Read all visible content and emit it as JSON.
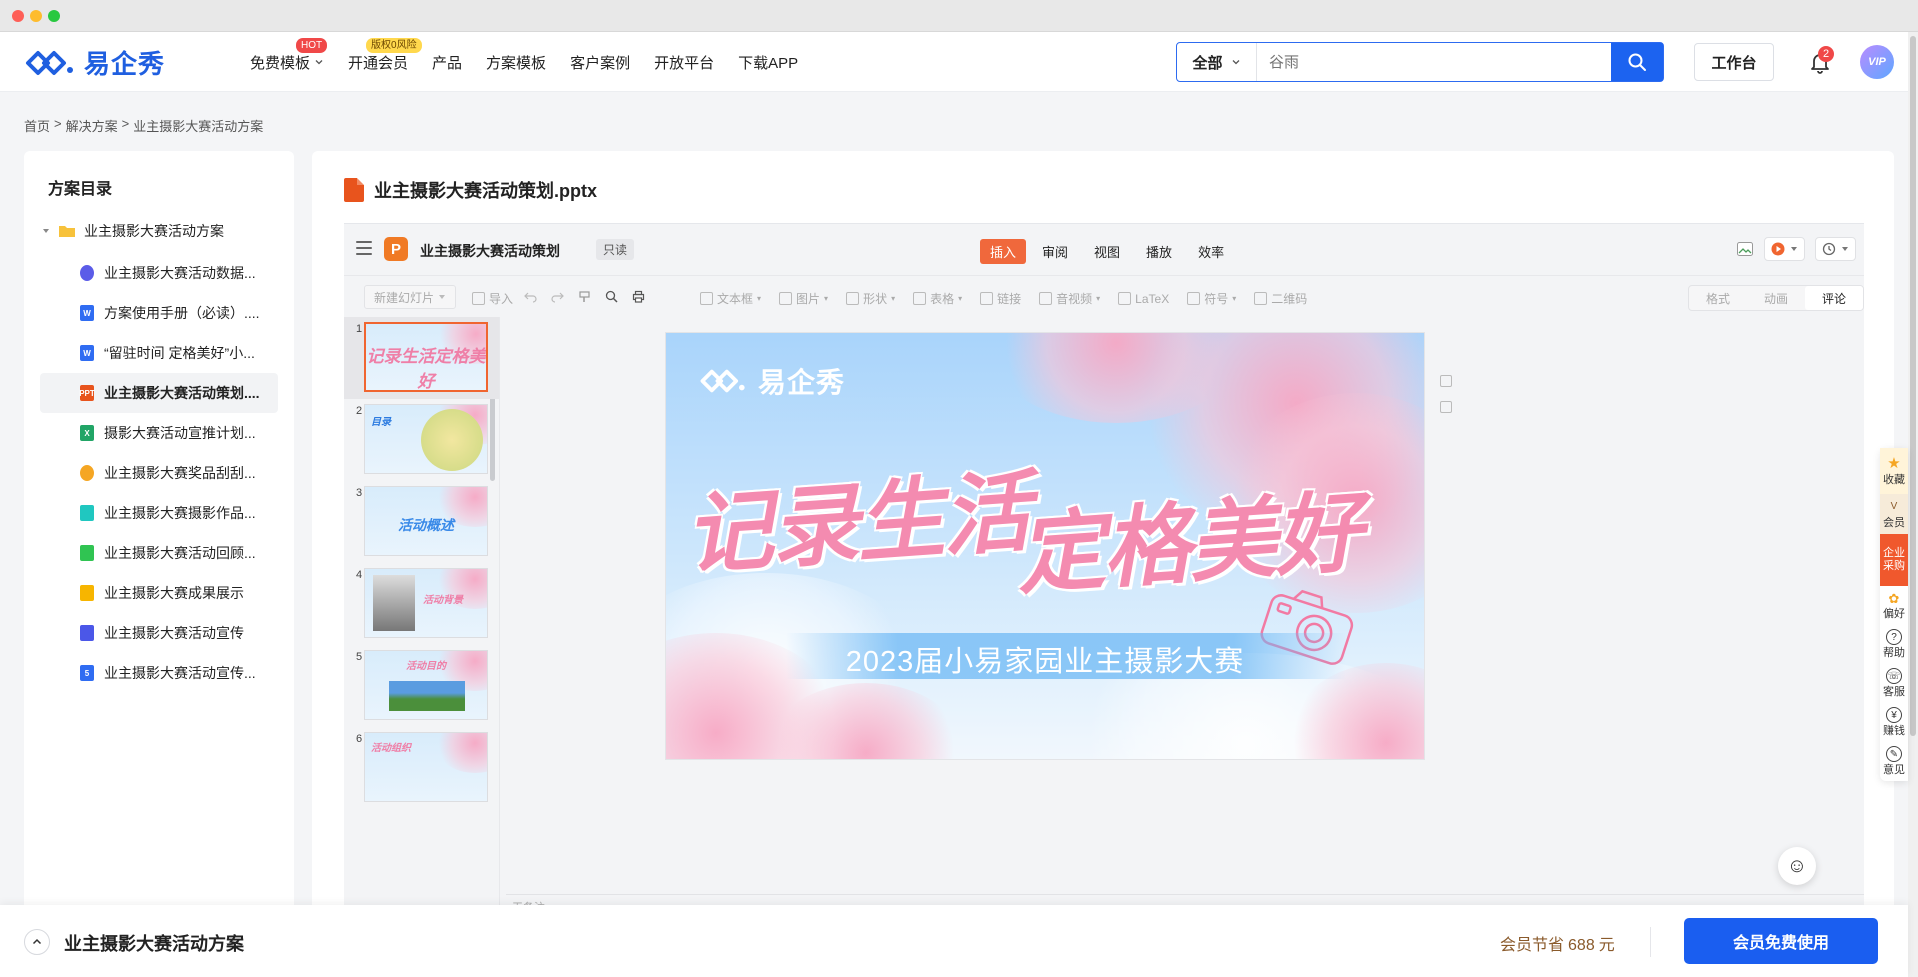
{
  "brand": {
    "name": "易企秀"
  },
  "nav": {
    "items": [
      {
        "label": "免费模板",
        "badge": "HOT"
      },
      {
        "label": "开通会员",
        "badge": "版权0风险"
      },
      {
        "label": "产品"
      },
      {
        "label": "方案模板"
      },
      {
        "label": "客户案例"
      },
      {
        "label": "开放平台"
      },
      {
        "label": "下载APP"
      }
    ]
  },
  "search": {
    "category": "全部",
    "value": "谷雨"
  },
  "header": {
    "workbench_label": "工作台",
    "notification_count": "2",
    "avatar_label": "VIP"
  },
  "breadcrumb": [
    "首页",
    ">",
    "解决方案",
    ">",
    "业主摄影大赛活动方案"
  ],
  "sidebar": {
    "title": "方案目录",
    "root": "业主摄影大赛活动方案",
    "items": [
      {
        "label": "业主摄影大赛活动数据...",
        "icon": "chart-file-icon",
        "color": "#5b5ce8"
      },
      {
        "label": "方案使用手册（必读）....",
        "icon": "word-file-icon",
        "color": "#2f6cf2",
        "glyph": "W"
      },
      {
        "label": "“留驻时间 定格美好”小...",
        "icon": "word-file-icon",
        "color": "#2f6cf2",
        "glyph": "W"
      },
      {
        "label": "业主摄影大赛活动策划....",
        "icon": "ppt-file-icon",
        "color": "#e8541d",
        "glyph": "PPT",
        "active": true
      },
      {
        "label": "摄影大赛活动宣推计划...",
        "icon": "excel-file-icon",
        "color": "#21a566",
        "glyph": "X"
      },
      {
        "label": "业主摄影大赛奖品刮刮...",
        "icon": "lottery-file-icon",
        "color": "#f5a623"
      },
      {
        "label": "业主摄影大赛摄影作品...",
        "icon": "form-file-icon",
        "color": "#20c7c0"
      },
      {
        "label": "业主摄影大赛活动回顾...",
        "icon": "video-file-icon",
        "color": "#30c452"
      },
      {
        "label": "业主摄影大赛成果展示",
        "icon": "doc-file-icon",
        "color": "#f7b500"
      },
      {
        "label": "业主摄影大赛活动宣传",
        "icon": "image-file-icon",
        "color": "#4b57e8"
      },
      {
        "label": "业主摄影大赛活动宣传...",
        "icon": "h5-file-icon",
        "color": "#2f6cf2",
        "glyph": "5"
      }
    ]
  },
  "document": {
    "title": "业主摄影大赛活动策划.pptx"
  },
  "viewer": {
    "name": "业主摄影大赛活动策划",
    "readonly": "只读",
    "tabs": [
      {
        "label": "插入",
        "active": true
      },
      {
        "label": "审阅"
      },
      {
        "label": "视图"
      },
      {
        "label": "播放"
      },
      {
        "label": "效率"
      }
    ],
    "toolbar": {
      "new_slide": "新建幻灯片",
      "import": "导入",
      "tools": [
        "文本框",
        "图片",
        "形状",
        "表格",
        "链接",
        "音视频",
        "LaTeX",
        "符号",
        "二维码"
      ]
    },
    "right_tabs": [
      {
        "label": "格式"
      },
      {
        "label": "动画"
      },
      {
        "label": "评论",
        "active": true
      }
    ],
    "notes_placeholder": "无备注"
  },
  "thumbnails": [
    {
      "num": "1",
      "text": "记录生活定格美好",
      "active": true
    },
    {
      "num": "2",
      "text": "目录"
    },
    {
      "num": "3",
      "text": "活动概述"
    },
    {
      "num": "4",
      "text": "活动背景"
    },
    {
      "num": "5",
      "text": "活动目的"
    },
    {
      "num": "6",
      "text": "活动组织"
    }
  ],
  "slide": {
    "logo_text": "易企秀",
    "headline_1": "记录生活",
    "headline_2": "定格美好",
    "subtitle": "2023届小易家园业主摄影大赛"
  },
  "right_panel": [
    {
      "label": "收藏",
      "icon": "star-icon"
    },
    {
      "label": "会员",
      "icon": "vip-icon"
    },
    {
      "label": "企业采购",
      "icon": "company-icon"
    },
    {
      "label": "偏好",
      "icon": "preference-icon"
    },
    {
      "label": "帮助",
      "icon": "help-icon"
    },
    {
      "label": "客服",
      "icon": "service-icon"
    },
    {
      "label": "赚钱",
      "icon": "money-icon"
    },
    {
      "label": "意见",
      "icon": "feedback-icon"
    }
  ],
  "footer": {
    "title": "业主摄影大赛活动方案",
    "save_prefix": "会员节省",
    "save_amount": "688",
    "save_unit": "元",
    "cta": "会员免费使用"
  },
  "colors": {
    "primary": "#1a5ef0",
    "accent": "#f0683c",
    "pink": "#f48bb0"
  }
}
